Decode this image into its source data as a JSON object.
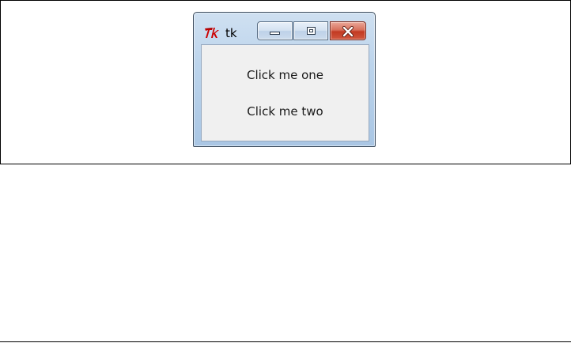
{
  "window": {
    "title": "tk"
  },
  "buttons": {
    "one_label": "Click me one",
    "two_label": "Click me two"
  },
  "icons": {
    "app": "tk-feather-icon",
    "minimize": "minimize-icon",
    "maximize": "maximize-icon",
    "close": "close-icon"
  },
  "colors": {
    "close_button": "#c23a22",
    "client_bg": "#f0f0f0",
    "titlebar": "#bcd4ec"
  }
}
